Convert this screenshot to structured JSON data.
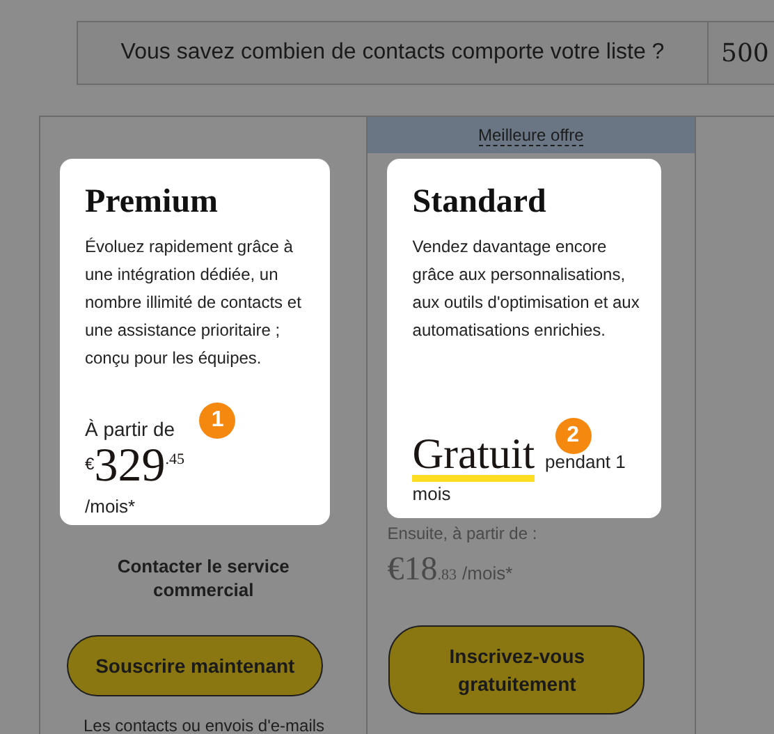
{
  "question": {
    "label": "Vous savez combien de contacts comporte votre liste ?",
    "value": "500"
  },
  "plans": [
    {
      "kind": "paid",
      "name": "Premium",
      "description": "Évoluez rapidement grâce à une intégration dédiée, un nombre illimité de contacts et une assistance prioritaire ; conçu pour les équipes.",
      "badge": "1",
      "from": "À partir de",
      "currency": "€",
      "price": "329",
      "cents": ".45",
      "period": "/mois*",
      "contact": "Contacter le service commercial",
      "button": "Souscrire maintenant",
      "footnote": "Les contacts ou envois d'e-mails"
    },
    {
      "kind": "free",
      "header": "Meilleure offre",
      "name": "Standard",
      "description": "Vendez davantage encore grâce aux personnalisations, aux outils d'optimisation et aux automatisations enrichies.",
      "badge": "2",
      "free": "Gratuit",
      "free_suffix": "pendant 1 mois",
      "then": "Ensuite, à partir de :",
      "currency": "€",
      "price": "18",
      "cents": ".83",
      "period": "/mois*",
      "button": "Inscrivez-vous gratuitement"
    }
  ]
}
